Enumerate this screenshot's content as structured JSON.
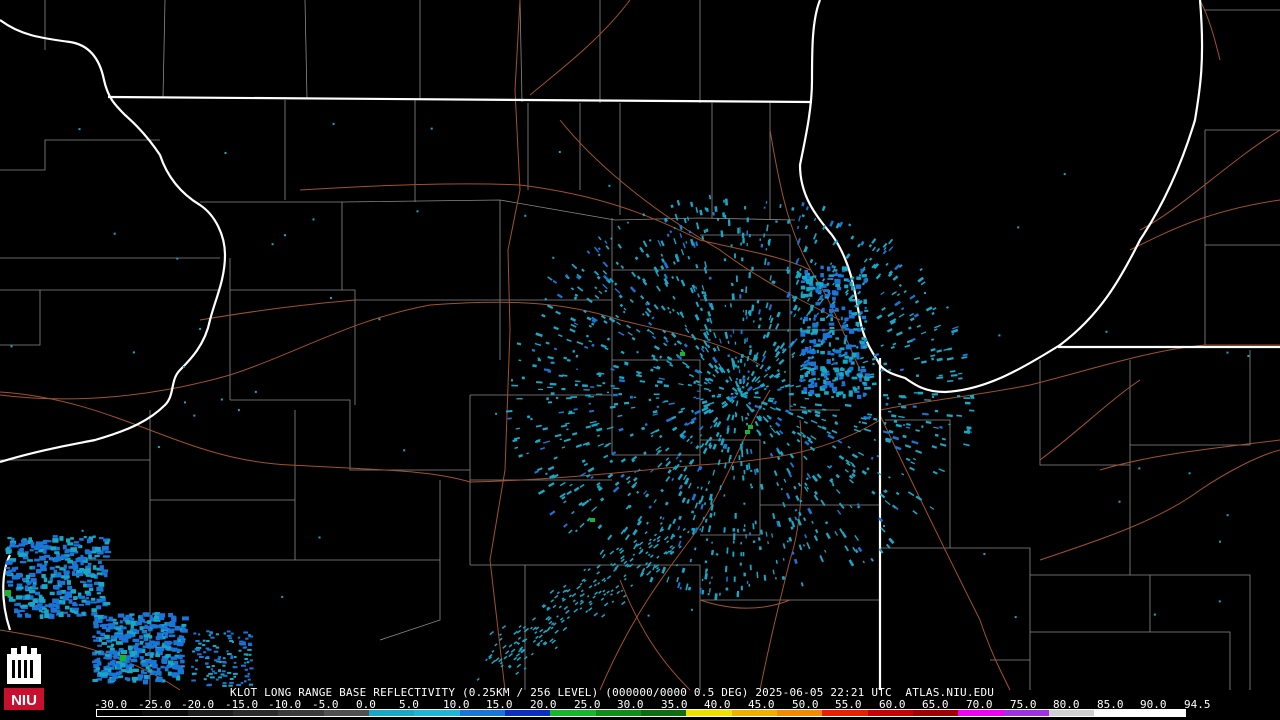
{
  "caption": "KLOT LONG RANGE BASE REFLECTIVITY (0.25KM / 256 LEVEL) (000000/0000 0.5 DEG) 2025-06-05 22:21 UTC  ATLAS.NIU.EDU",
  "logo_text": "NIU",
  "scale": {
    "ticks": [
      "-30.0",
      "-25.0",
      "-20.0",
      "-15.0",
      "-10.0",
      "-5.0",
      "0.0",
      "5.0",
      "10.0",
      "15.0",
      "20.0",
      "25.0",
      "30.0",
      "35.0",
      "40.0",
      "45.0",
      "50.0",
      "55.0",
      "60.0",
      "65.0",
      "70.0",
      "75.0",
      "80.0",
      "85.0",
      "90.0",
      "94.5"
    ],
    "colors": [
      "#000000",
      "#0b0b0b",
      "#1c1c1c",
      "#2b2b2b",
      "#3a3a3a",
      "#505050",
      "#19a7c6",
      "#1fb6d6",
      "#1a75d8",
      "#0a2fc4",
      "#16b72a",
      "#0f8f16",
      "#0d6d10",
      "#f0e000",
      "#f0b000",
      "#f08a00",
      "#e82000",
      "#c80000",
      "#a00000",
      "#f000f0",
      "#a030e0",
      "#d0d0d0",
      "#ffffff",
      "#ffffff"
    ]
  },
  "colors": {
    "state_border": "#ffffff",
    "county_border": "#8a8a8a",
    "roads": "#a0522d",
    "echo_light": "#19a7c6",
    "echo_mid": "#1a75d8",
    "echo_green": "#16b72a"
  }
}
